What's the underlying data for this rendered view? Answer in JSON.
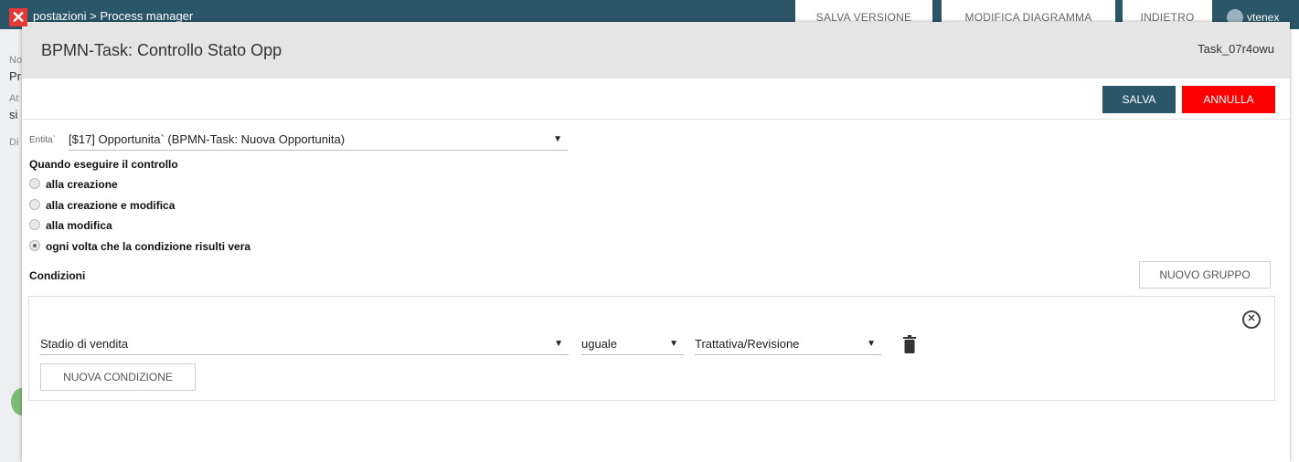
{
  "background": {
    "breadcrumb": "postazioni > Process manager",
    "buttons": {
      "salva_versione": "SALVA VERSIONE",
      "modifica_diagramma": "MODIFICA DIAGRAMMA",
      "indietro": "INDIETRO"
    },
    "user": "vtenex",
    "side_letters": [
      "No",
      "Pr",
      "At",
      "si",
      "Di"
    ]
  },
  "modal": {
    "title": "BPMN-Task: Controllo Stato Opp",
    "task_id": "Task_07r4owu",
    "toolbar": {
      "salva": "SALVA",
      "annulla": "ANNULLA"
    },
    "entity": {
      "label": "Entita`",
      "value": "[$17] Opportunita` (BPMN-Task: Nuova Opportunita)"
    },
    "when_title": "Quando eseguire il controllo",
    "options": [
      {
        "label": "alla creazione",
        "selected": false
      },
      {
        "label": "alla creazione e modifica",
        "selected": false
      },
      {
        "label": "alla modifica",
        "selected": false
      },
      {
        "label": "ogni volta che la condizione risulti vera",
        "selected": true
      }
    ],
    "conditions_title": "Condizioni",
    "nuovo_gruppo": "NUOVO GRUPPO",
    "group": {
      "field": "Stadio di vendita",
      "operator": "uguale",
      "value": "Trattativa/Revisione",
      "nuova_condizione": "NUOVA CONDIZIONE"
    }
  },
  "colors": {
    "primary": "#2b5668",
    "danger": "#ff0000",
    "close_badge": "#e53935"
  }
}
